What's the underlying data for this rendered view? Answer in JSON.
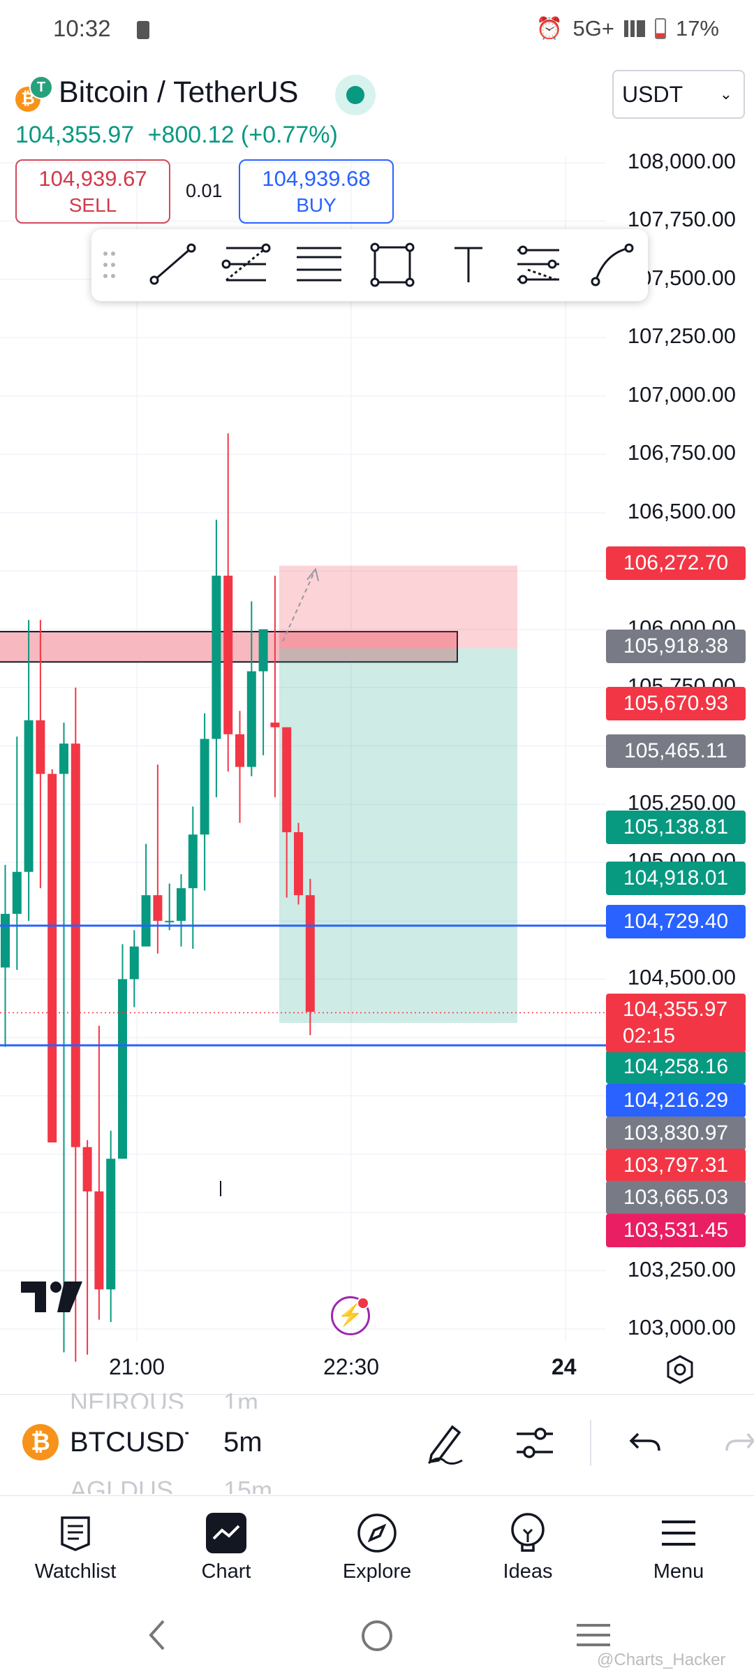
{
  "status_bar": {
    "time": "10:32",
    "network": "5G+",
    "battery": "17%"
  },
  "header": {
    "symbol_title": "Bitcoin / TetherUS",
    "last_price": "104,355.97",
    "change": "+800.12 (+0.77%)",
    "currency": "USDT",
    "sell_price": "104,939.67",
    "sell_label": "SELL",
    "quantity": "0.01",
    "buy_price": "104,939.68",
    "buy_label": "BUY"
  },
  "drawing_toolbar": {
    "tools": [
      "drag-handle-icon",
      "trend-line-icon",
      "fib-retracement-icon",
      "parallel-channel-icon",
      "rectangle-icon",
      "text-icon",
      "pitchfork-icon",
      "path-icon"
    ]
  },
  "price_axis": {
    "labels": [
      "108,000.00",
      "107,750.00",
      "107,500.00",
      "107,250.00",
      "107,000.00",
      "106,750.00",
      "106,500.00",
      "106,000.00",
      "105,750.00",
      "105,500.00",
      "105,250.00",
      "105,000.00",
      "104,500.00",
      "103,250.00",
      "103,000.00"
    ]
  },
  "price_tags": [
    {
      "value": "106,272.70",
      "color": "#f23645"
    },
    {
      "value": "105,918.38",
      "color": "#787b86"
    },
    {
      "value": "105,670.93",
      "color": "#f23645"
    },
    {
      "value": "105,465.11",
      "color": "#787b86"
    },
    {
      "value": "105,138.81",
      "color": "#089981"
    },
    {
      "value": "104,918.01",
      "color": "#089981"
    },
    {
      "value": "104,729.40",
      "color": "#2962ff"
    },
    {
      "value": "104,258.16",
      "color": "#089981"
    },
    {
      "value": "104,216.29",
      "color": "#2962ff"
    },
    {
      "value": "103,830.97",
      "color": "#787b86"
    },
    {
      "value": "103,797.31",
      "color": "#f23645"
    },
    {
      "value": "103,665.03",
      "color": "#787b86"
    },
    {
      "value": "103,531.45",
      "color": "#e91e63"
    }
  ],
  "last_price_tag": {
    "value": "104,355.97",
    "countdown": "02:15"
  },
  "time_axis": {
    "labels": [
      "21:00",
      "22:30",
      "24"
    ]
  },
  "symbol_bar": {
    "prev_symbol": "NEIROUS",
    "prev_interval": "1m",
    "symbol": "BTCUSDT",
    "interval": "5m",
    "next_symbol": "AGLDUS",
    "next_interval": "15m"
  },
  "bottom_nav": [
    {
      "label": "Watchlist",
      "icon": "watchlist-icon"
    },
    {
      "label": "Chart",
      "icon": "chart-icon"
    },
    {
      "label": "Explore",
      "icon": "compass-icon"
    },
    {
      "label": "Ideas",
      "icon": "lightbulb-icon"
    },
    {
      "label": "Menu",
      "icon": "menu-icon"
    }
  ],
  "watermark": "@Charts_Hacker",
  "colors": {
    "up": "#089981",
    "down": "#f23645",
    "accent": "#2962ff"
  },
  "chart_data": {
    "type": "candlestick",
    "x": [
      "20:25",
      "20:30",
      "20:35",
      "20:40",
      "20:45",
      "20:50",
      "20:55",
      "21:00",
      "21:05",
      "21:10",
      "21:15",
      "21:20",
      "21:25",
      "21:30",
      "21:35",
      "21:40",
      "21:45",
      "21:50",
      "21:55",
      "22:00",
      "22:05",
      "22:10",
      "22:15",
      "22:20",
      "22:25",
      "22:30",
      "22:35"
    ],
    "open": [
      104550,
      104780,
      104960,
      105610,
      105380,
      105380,
      105510,
      103780,
      103590,
      103170,
      103730,
      104500,
      104640,
      104860,
      104750,
      104750,
      104890,
      105120,
      105530,
      106230,
      105550,
      105410,
      105820,
      105600,
      105580,
      105130,
      104860
    ],
    "high": [
      104990,
      105540,
      106040,
      106040,
      105400,
      105600,
      105750,
      103810,
      104300,
      103850,
      104650,
      104710,
      105080,
      105420,
      104910,
      104950,
      105240,
      105640,
      106470,
      106840,
      105650,
      106120,
      105920,
      106230,
      105480,
      105170,
      104930
    ],
    "low": [
      104210,
      104540,
      104750,
      104890,
      104810,
      102900,
      102860,
      102890,
      103040,
      103030,
      104190,
      104380,
      104800,
      104610,
      104710,
      104640,
      104630,
      104880,
      105280,
      105390,
      105170,
      105370,
      105460,
      105280,
      104850,
      104820,
      104260
    ],
    "close": [
      104780,
      104960,
      105610,
      105380,
      103800,
      105510,
      103780,
      103590,
      103170,
      103730,
      104500,
      104640,
      104860,
      104750,
      104750,
      104890,
      105120,
      105530,
      106230,
      105550,
      105410,
      105820,
      106000,
      105580,
      105130,
      104860,
      104360
    ],
    "ylim": [
      102950,
      108100
    ],
    "levels": {
      "blue_lines": [
        104729.4,
        104216.29
      ],
      "last_price": 104355.97
    },
    "short_position": {
      "entry": 105918.38,
      "stop": 106272.7,
      "target": 104258.16
    }
  }
}
